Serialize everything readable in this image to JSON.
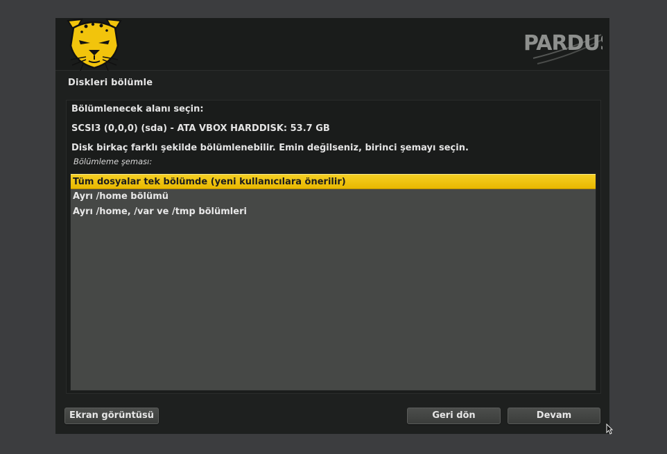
{
  "header": {
    "brand_text": "PARDUS"
  },
  "page": {
    "title": "Diskleri bölümle"
  },
  "content": {
    "select_area_label": "Bölümlenecek alanı seçin:",
    "disk_label": "SCSI3 (0,0,0) (sda) - ATA VBOX HARDDISK: 53.7 GB",
    "instruction": "Disk birkaç farklı şekilde bölümlenebilir. Emin değilseniz, birinci şemayı seçin.",
    "scheme_label": "Bölümleme şeması:",
    "schemes": [
      {
        "label": "Tüm dosyalar tek bölümde (yeni kullanıcılara önerilir)",
        "selected": true
      },
      {
        "label": "Ayrı /home bölümü",
        "selected": false
      },
      {
        "label": "Ayrı /home, /var ve /tmp bölümleri",
        "selected": false
      }
    ]
  },
  "buttons": {
    "screenshot_label": "Ekran görüntüsü",
    "back_label": "Geri dön",
    "continue_label": "Devam"
  },
  "colors": {
    "accent": "#f2c40c",
    "window_bg": "#1e201f",
    "desktop_bg": "#3c3d3f",
    "list_bg": "#464846"
  }
}
